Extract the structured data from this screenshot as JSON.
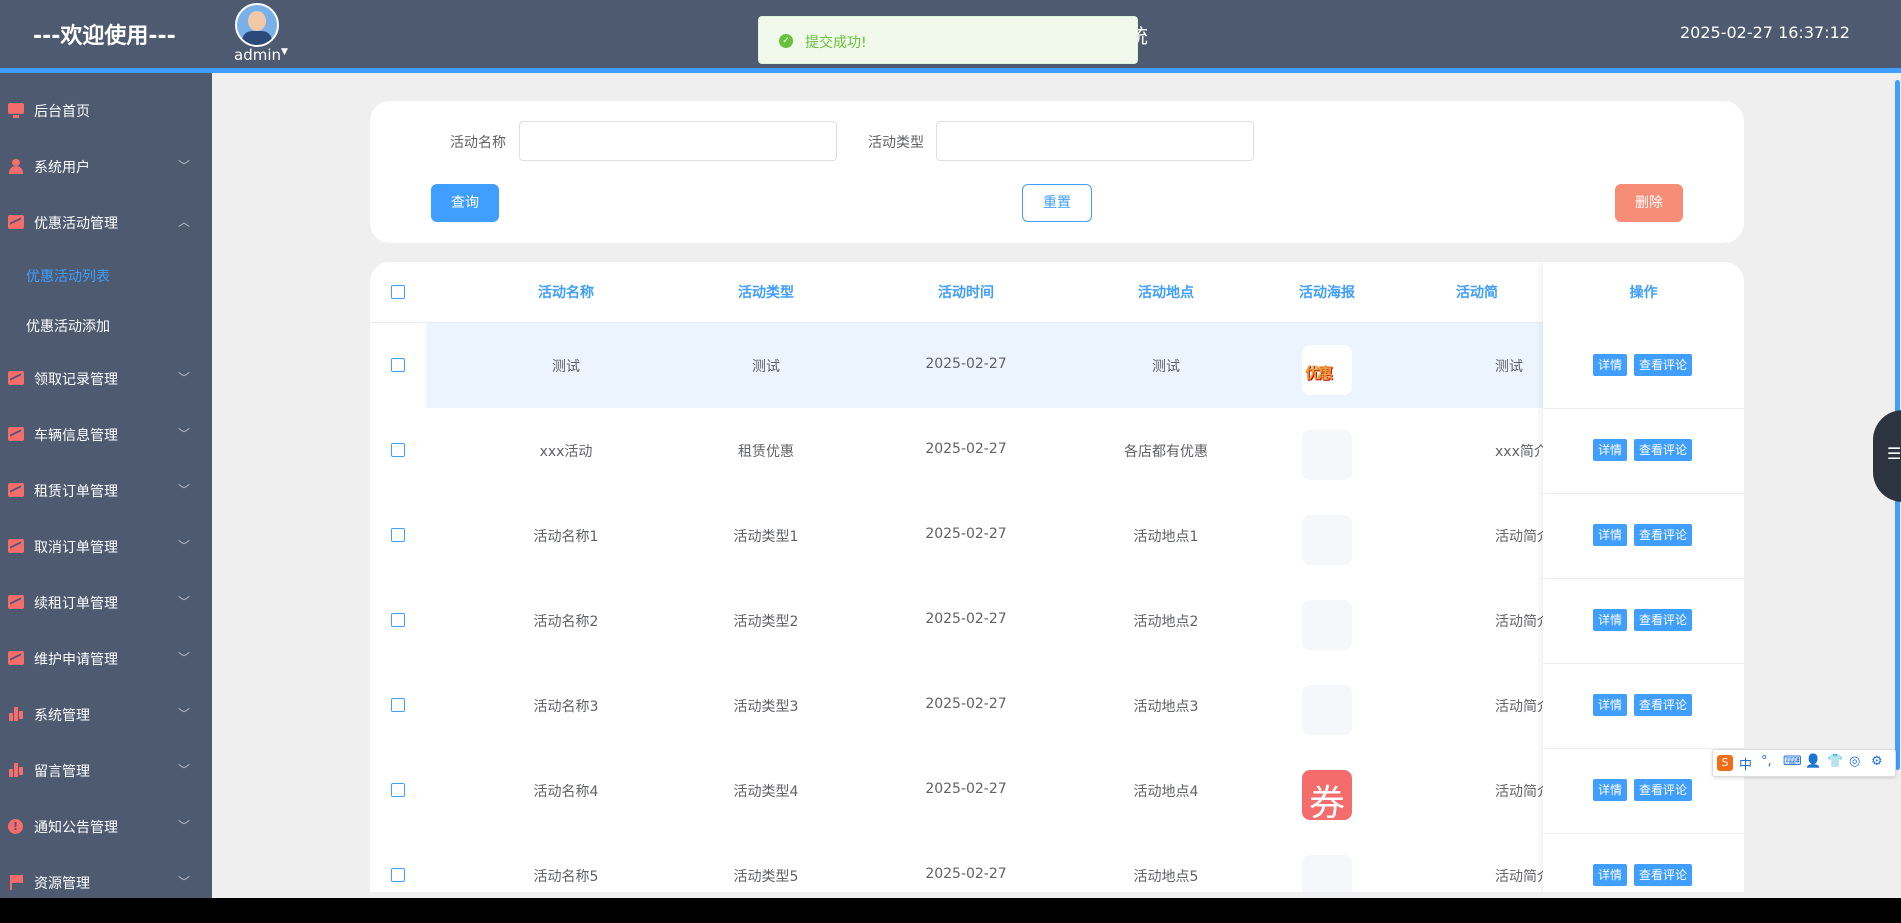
{
  "header": {
    "welcome": "---欢迎使用---",
    "username": "admin",
    "system_title_tail": "统",
    "datetime": "2025-02-27 16:37:12"
  },
  "toast": {
    "message": "提交成功!"
  },
  "sidebar": {
    "items": [
      {
        "label": "后台首页",
        "icon": "monitor-icon"
      },
      {
        "label": "系统用户",
        "icon": "user-icon"
      },
      {
        "label": "优惠活动管理",
        "icon": "chart-icon"
      },
      {
        "label": "优惠活动列表"
      },
      {
        "label": "优惠活动添加"
      },
      {
        "label": "领取记录管理",
        "icon": "chart-icon"
      },
      {
        "label": "车辆信息管理",
        "icon": "chart-icon"
      },
      {
        "label": "租赁订单管理",
        "icon": "chart-icon"
      },
      {
        "label": "取消订单管理",
        "icon": "chart-icon"
      },
      {
        "label": "续租订单管理",
        "icon": "chart-icon"
      },
      {
        "label": "维护申请管理",
        "icon": "chart-icon"
      },
      {
        "label": "系统管理",
        "icon": "bar-chart-icon"
      },
      {
        "label": "留言管理",
        "icon": "bar-chart-icon"
      },
      {
        "label": "通知公告管理",
        "icon": "info-icon"
      },
      {
        "label": "资源管理",
        "icon": "flag-icon"
      }
    ]
  },
  "search": {
    "name_label": "活动名称",
    "name_value": "",
    "type_label": "活动类型",
    "type_value": "",
    "query_button": "查询",
    "reset_button": "重置",
    "delete_button": "删除"
  },
  "table": {
    "headers": [
      "活动名称",
      "活动类型",
      "活动时间",
      "活动地点",
      "活动海报",
      "活动简",
      "操作"
    ],
    "rows": [
      {
        "name": "测试",
        "type": "测试",
        "time": "2025-02-27",
        "place": "测试",
        "poster": "优惠",
        "intro": "测试"
      },
      {
        "name": "xxx活动",
        "type": "租赁优惠",
        "time": "2025-02-27",
        "place": "各店都有优惠",
        "poster": "",
        "intro": "xxx简介"
      },
      {
        "name": "活动名称1",
        "type": "活动类型1",
        "time": "2025-02-27",
        "place": "活动地点1",
        "poster": "",
        "intro": "活动简介"
      },
      {
        "name": "活动名称2",
        "type": "活动类型2",
        "time": "2025-02-27",
        "place": "活动地点2",
        "poster": "",
        "intro": "活动简介"
      },
      {
        "name": "活动名称3",
        "type": "活动类型3",
        "time": "2025-02-27",
        "place": "活动地点3",
        "poster": "",
        "intro": "活动简介"
      },
      {
        "name": "活动名称4",
        "type": "活动类型4",
        "time": "2025-02-27",
        "place": "活动地点4",
        "poster": "券",
        "intro": "活动简介"
      },
      {
        "name": "活动名称5",
        "type": "活动类型5",
        "time": "2025-02-27",
        "place": "活动地点5",
        "poster": "",
        "intro": "活动简介"
      }
    ],
    "detail_button": "详情",
    "comment_button": "查看评论"
  },
  "ime": {
    "items": [
      "中",
      "°,",
      "⌨",
      "👤",
      "👕",
      "◎",
      "⚙"
    ]
  },
  "colors": {
    "accent": "#409eff",
    "sidebar": "#4d5a70",
    "danger": "#f78c77",
    "success": "#67c23a"
  }
}
